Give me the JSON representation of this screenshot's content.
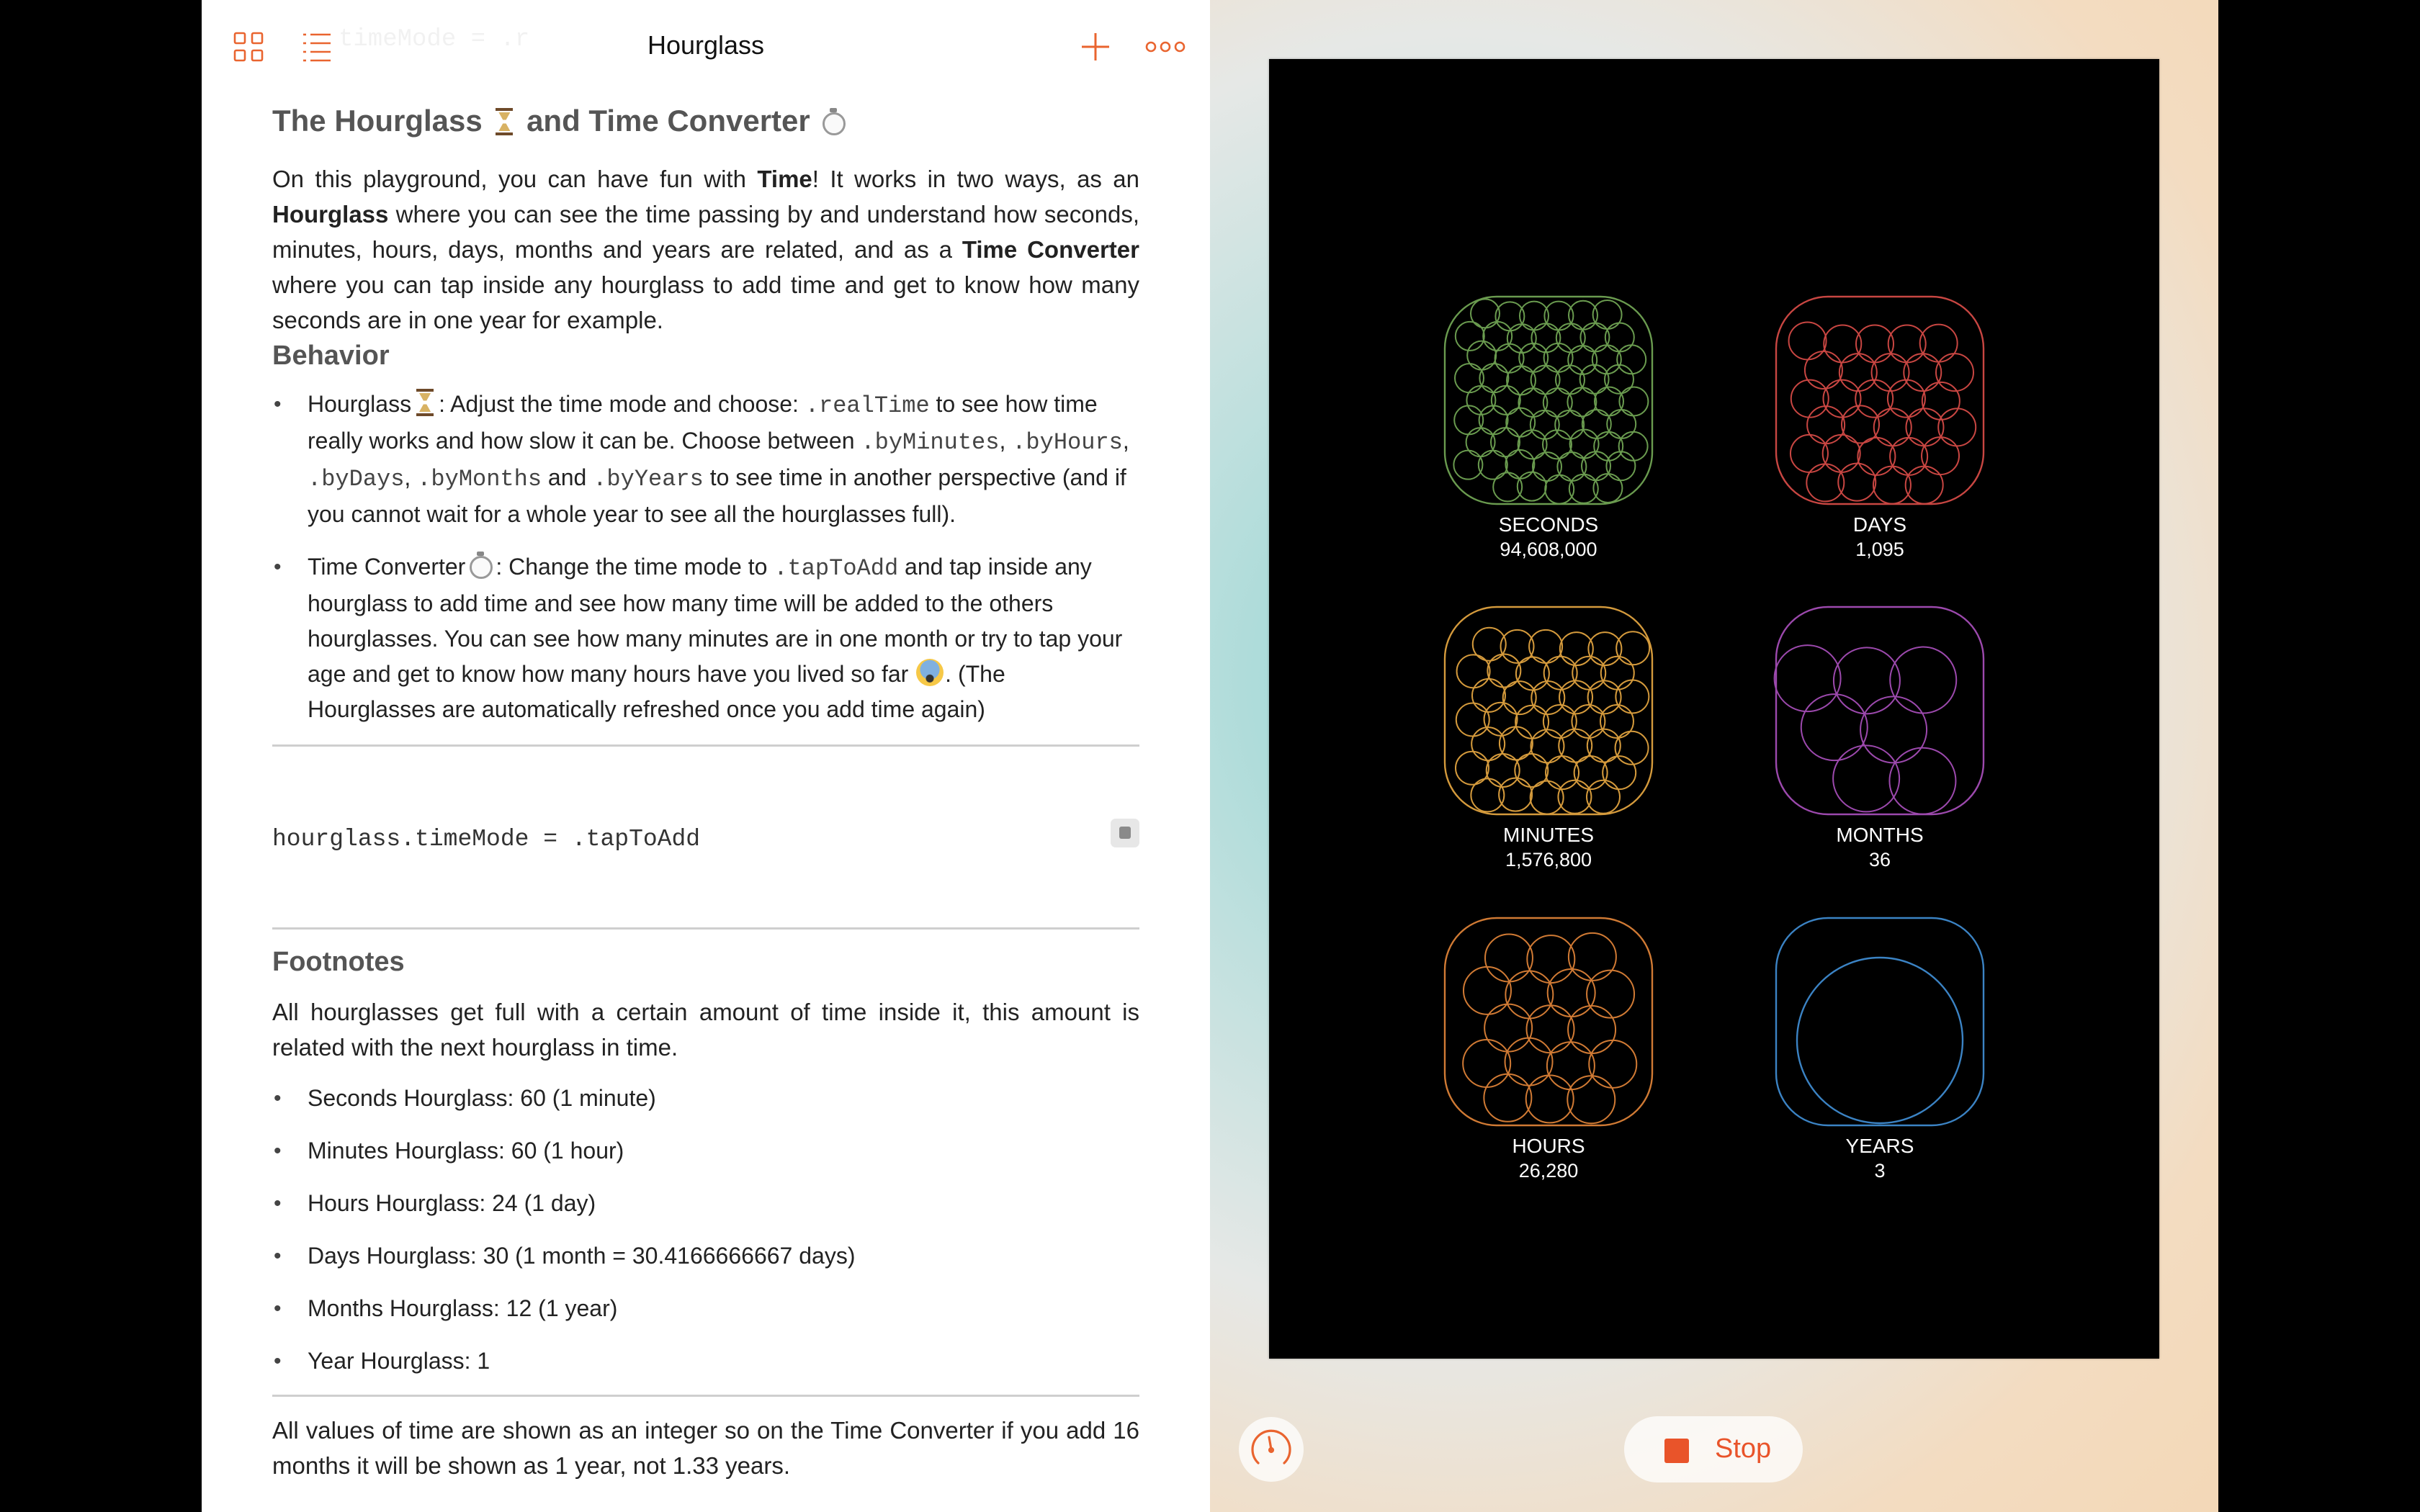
{
  "toolbar": {
    "title": "Hourglass",
    "ghost_code": "timeMode = .r",
    "icons": [
      "grid-icon",
      "list-icon",
      "plus-icon",
      "more-icon"
    ],
    "accent": "#e9642f"
  },
  "doc": {
    "heading": "The Hourglass",
    "heading_and": "and Time Converter",
    "intro": {
      "t1": "On this playground, you can have fun with ",
      "b1": "Time",
      "t2": "! It works in two ways, as an ",
      "b2": "Hourglass",
      "t3": " where you can see the time passing by and understand how seconds, minutes, hours, days, months and years are related, and as a ",
      "b3": "Time Converter",
      "t4": " where you can tap inside any hourglass to add time and get to know how many seconds are in one year for example."
    },
    "behavior_heading": "Behavior",
    "bullet1": {
      "a": "Hourglass",
      "b": ": Adjust the time mode and choose: ",
      "c1": ".realTime",
      "d": " to see how time really works and how slow it can be. Choose between ",
      "c2": ".byMinutes",
      "c3": ".byHours",
      "c4": ".byDays",
      "c5": ".byMonths",
      "e": " and ",
      "c6": ".byYears",
      "f": " to see time in another perspective (and if you cannot wait for a whole year to see all the hourglasses full).",
      "sep": ", "
    },
    "bullet2": {
      "a": "Time Converter",
      "b": ": Change the time mode to ",
      "c1": ".tapToAdd",
      "d": " and tap inside any hourglass to add time and see how many time will be added to the others hourglasses. You can see how many minutes are in one month or try to tap your age and get to know how many hours have you lived so far ",
      "e": ". (The Hourglasses are automatically refreshed once you add time again)"
    },
    "code_line": "hourglass.timeMode = .tapToAdd",
    "footnotes_heading": "Footnotes",
    "footnotes_intro": "All hourglasses get full with a certain amount of time inside it, this amount is related with the next hourglass in time.",
    "footnotes": [
      "Seconds Hourglass: 60 (1 minute)",
      "Minutes Hourglass: 60 (1 hour)",
      "Hours Hourglass: 24 (1 day)",
      "Days Hourglass: 30 (1 month = 30.4166666667 days)",
      "Months Hourglass: 12 (1 year)",
      "Year Hourglass: 1"
    ],
    "closing": "All values of time are shown as an integer so on the Time Converter if you add 16 months it will be shown as 1 year, not 1.33 years."
  },
  "live": {
    "hourglasses": [
      {
        "label": "SECONDS",
        "value": "94,608,000",
        "color": "#6a9b4f",
        "fill_level": 1.0
      },
      {
        "label": "DAYS",
        "value": "1,095",
        "color": "#c84642",
        "fill_level": 1.0
      },
      {
        "label": "MINUTES",
        "value": "1,576,800",
        "color": "#d49a3c",
        "fill_level": 1.0
      },
      {
        "label": "MONTHS",
        "value": "36",
        "color": "#9c49ad",
        "fill_level": 1.0
      },
      {
        "label": "HOURS",
        "value": "26,280",
        "color": "#d07a34",
        "fill_level": 1.0
      },
      {
        "label": "YEARS",
        "value": "3",
        "color": "#3b83c4",
        "fill_level": 1.0
      }
    ],
    "stop_label": "Stop"
  }
}
